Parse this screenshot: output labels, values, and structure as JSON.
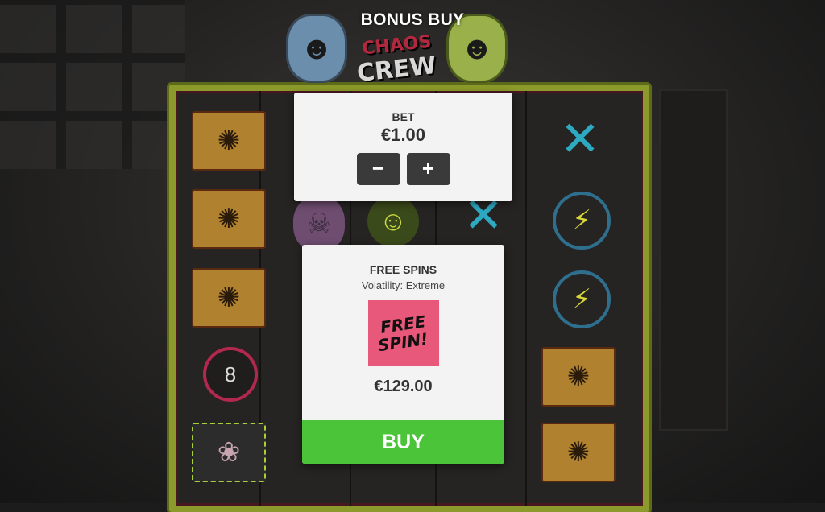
{
  "header": {
    "title": "BONUS BUY"
  },
  "logo": {
    "left_icon": "bat-monster-face-icon",
    "right_icon": "zombie-face-icon",
    "word_top": "CHAOS",
    "word_bottom": "CREW"
  },
  "bet": {
    "label": "BET",
    "value": "€1.00",
    "decrease_label": "−",
    "increase_label": "+"
  },
  "offer": {
    "title": "FREE SPINS",
    "volatility": "Volatility: Extreme",
    "image_text_line1": "FREE",
    "image_text_line2": "SPIN!",
    "price": "€129.00",
    "buy_label": "BUY"
  },
  "colors": {
    "buy_button": "#4cc43a",
    "panel_bg": "#f3f3f3",
    "stepper_bg": "#3a3a3a",
    "frame_green": "#8b9a2a"
  }
}
